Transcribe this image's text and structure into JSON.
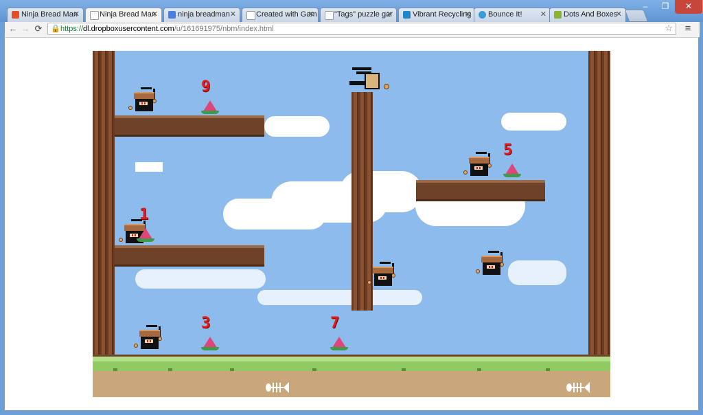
{
  "browser": {
    "tabs": [
      {
        "title": "Ninja Bread Man",
        "active": false,
        "icon": "html5-icon"
      },
      {
        "title": "Ninja Bread Man",
        "active": true,
        "icon": "page-icon"
      },
      {
        "title": "ninja breadman -",
        "active": false,
        "icon": "google-icon"
      },
      {
        "title": "Created with Gam",
        "active": false,
        "icon": "page-icon"
      },
      {
        "title": "\"Tags\" puzzle gar",
        "active": false,
        "icon": "page-icon"
      },
      {
        "title": "Vibrant Recycling",
        "active": false,
        "icon": "recycle-icon"
      },
      {
        "title": "Bounce It!",
        "active": false,
        "icon": "globe-icon"
      },
      {
        "title": "Dots And Boxes",
        "active": false,
        "icon": "leaf-icon"
      }
    ],
    "url": {
      "protocol": "https://",
      "host": "dl.dropboxusercontent.com",
      "path": "/u/161691975/nbm/index.html"
    },
    "window_controls": {
      "minimize": "–",
      "maximize": "❐",
      "close": "✕"
    },
    "nav": {
      "back": "←",
      "forward": "→",
      "reload": "⟳",
      "star": "☆",
      "menu": "≡"
    }
  },
  "game": {
    "melon_counters": [
      "9",
      "5",
      "1",
      "3",
      "7"
    ],
    "colors": {
      "sky": "#8dbcec",
      "counter": "#e21b1b",
      "grass": "#8fcb62",
      "dirt": "#c9a77a"
    }
  }
}
